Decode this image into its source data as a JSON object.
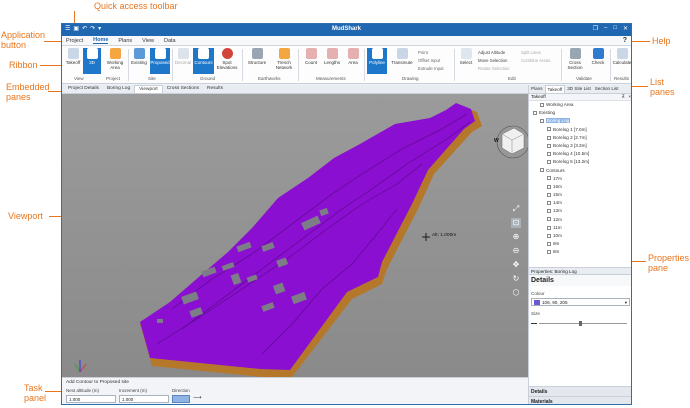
{
  "callouts": {
    "quick_access": "Quick access toolbar",
    "app_button": "Application\nbutton",
    "ribbon": "Ribbon",
    "embedded": "Embedded\npanes",
    "viewport": "Viewport",
    "task_panel": "Task\npanel",
    "help": "Help",
    "list_panes": "List\npanes",
    "properties_pane": "Properties\npane"
  },
  "window": {
    "title": "MudShark"
  },
  "menu": {
    "project": "Project",
    "tabs": [
      "Home",
      "Plans",
      "View",
      "Data"
    ],
    "help": "?"
  },
  "ribbon": {
    "buttons": [
      "Takeoff",
      "3D",
      "Working Area",
      "Existing",
      "Proposed",
      "Decimal",
      "Contours",
      "Spot Elevations",
      "Structure",
      "Trench Network",
      "Count",
      "Lengths",
      "Area",
      "Polyline",
      "Transmute",
      "Select",
      "Cross Section",
      "Check",
      "Calculate"
    ],
    "small": [
      "Point",
      "Offset Input",
      "Extrude Input",
      "Adjust Altitude",
      "Move Selection",
      "Rotate Selection",
      "Split Lines",
      "Combine Areas"
    ],
    "groups": [
      "View",
      "Project",
      "Site",
      "Ground",
      "Earthworks",
      "Measurements",
      "Drawing",
      "Edit",
      "Validate",
      "Results"
    ]
  },
  "panes": {
    "tabs": [
      "Project Details",
      "Boring Log",
      "Viewport",
      "Cross Sections",
      "Results"
    ]
  },
  "viewport": {
    "altitude": "Alt: 1.000m",
    "cube_label": "W"
  },
  "task": {
    "title": "Add Contour to Proposed site",
    "next_label": "Next altitude (m)",
    "next_value": "1.000",
    "inc_label": "Increment (m)",
    "inc_value": "1.000",
    "dir_label": "Direction"
  },
  "list": {
    "tabs": [
      "Plans",
      "Takeoff",
      "3D Site List",
      "Section List"
    ],
    "header": "Takeoff",
    "items": [
      {
        "label": "Working Area",
        "depth": 1
      },
      {
        "label": "Existing",
        "depth": 0
      },
      {
        "label": "Boring Log",
        "depth": 1,
        "selected": true
      },
      {
        "label": "Borelog 1 [7.0m]",
        "depth": 2
      },
      {
        "label": "Borelog 2 [2.7m]",
        "depth": 2
      },
      {
        "label": "Borelog 3 [3.3m]",
        "depth": 2
      },
      {
        "label": "Borelog 4 [10.5m]",
        "depth": 2
      },
      {
        "label": "Borelog 5 [13.2m]",
        "depth": 2
      },
      {
        "label": "Contours",
        "depth": 1
      },
      {
        "label": "17m",
        "depth": 2
      },
      {
        "label": "16m",
        "depth": 2
      },
      {
        "label": "15m",
        "depth": 2
      },
      {
        "label": "14m",
        "depth": 2
      },
      {
        "label": "13m",
        "depth": 2
      },
      {
        "label": "12m",
        "depth": 2
      },
      {
        "label": "11m",
        "depth": 2
      },
      {
        "label": "10m",
        "depth": 2
      },
      {
        "label": "9m",
        "depth": 2
      },
      {
        "label": "8m",
        "depth": 2
      }
    ]
  },
  "properties": {
    "header": "Properties: Boring Log",
    "details": "Details",
    "colour_label": "Colour",
    "colour_value": "106, 90, 205",
    "size_label": "Size",
    "accordion": [
      "Details",
      "Materials"
    ]
  },
  "colors": {
    "terrain": "#8a0fd0",
    "terrain_edge": "#c58a2a",
    "accent": "#1f67b1",
    "callout": "#e8761e",
    "swatch": "#6a5acd"
  }
}
